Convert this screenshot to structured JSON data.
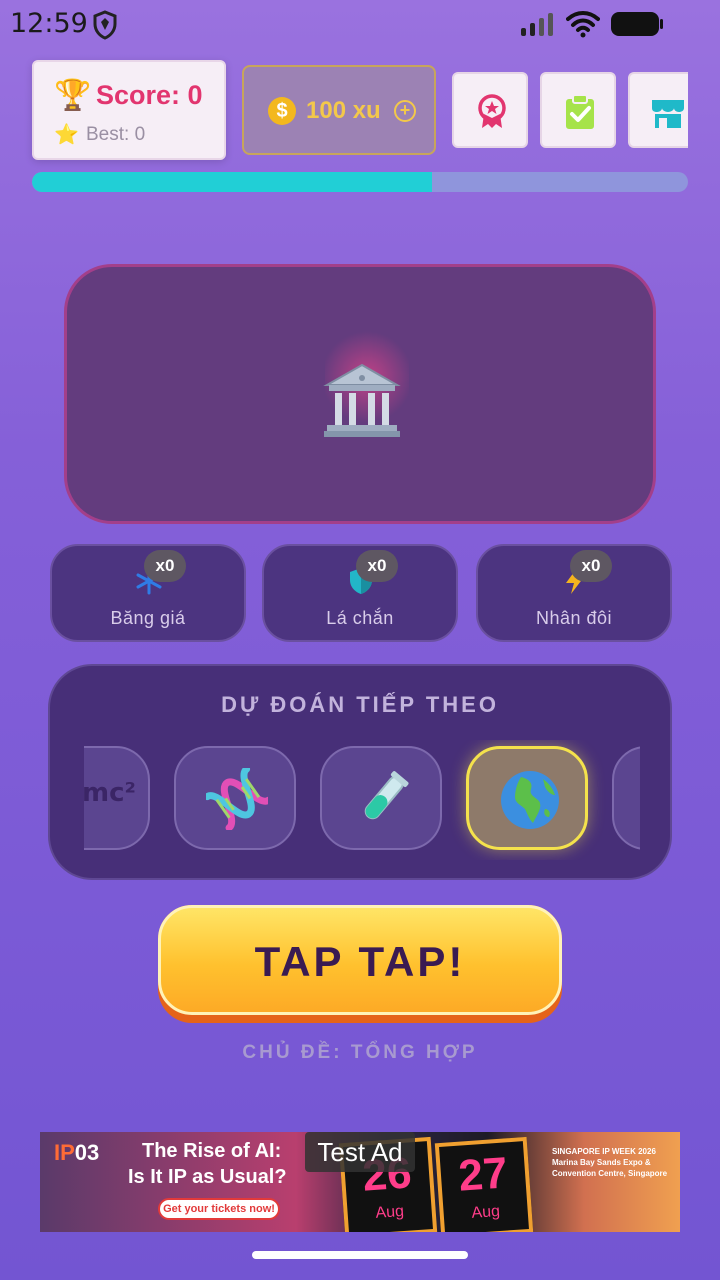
{
  "status_bar": {
    "time": "12:59",
    "icons": [
      "shield-icon",
      "signal-icon",
      "wifi-icon",
      "battery-icon"
    ]
  },
  "score_card": {
    "score_label": "Score: 0",
    "best_label": "Best: 0",
    "trophy_icon": "🏆",
    "star_icon": "⭐"
  },
  "coins": {
    "label": "100 xu",
    "coin_symbol": "$",
    "plus_symbol": "+"
  },
  "top_buttons": [
    {
      "name": "achievements",
      "icon": "medal-icon",
      "color": "#e2356f"
    },
    {
      "name": "tasks",
      "icon": "clipboard-check-icon",
      "color": "#a6e34a"
    },
    {
      "name": "shop",
      "icon": "store-icon",
      "color": "#1fb9c9"
    }
  ],
  "progress": {
    "fraction": 0.61,
    "fill_color": "#21cfd6",
    "track_color": "#8f95dc"
  },
  "display": {
    "current_item": "bank-building-icon",
    "glow_color": "#ff468c"
  },
  "powerups": [
    {
      "label": "Băng giá",
      "count": "x0",
      "icon": "snowflake-icon",
      "color": "#2f7ce6"
    },
    {
      "label": "Lá chắn",
      "count": "x0",
      "icon": "shield-icon",
      "color": "#22b6c8"
    },
    {
      "label": "Nhân đôi",
      "count": "x0",
      "icon": "lightning-icon",
      "color": "#f4b41e"
    }
  ],
  "prediction": {
    "title": "DỰ ĐOÁN TIẾP THEO",
    "tiles": [
      {
        "label": "mc²",
        "icon": "formula-icon",
        "active": false
      },
      {
        "label": "",
        "icon": "dna-icon",
        "active": false
      },
      {
        "label": "",
        "icon": "test-tube-icon",
        "active": false
      },
      {
        "label": "",
        "icon": "globe-icon",
        "active": true
      }
    ],
    "active_border": "#f4e24c"
  },
  "tap_button": {
    "label": "TAP TAP!"
  },
  "topic": {
    "label": "CHỦ ĐỀ: TỔNG HỢP"
  },
  "ad": {
    "test_label": "Test Ad",
    "logo_prefix": "IP",
    "logo_suffix": "03",
    "headline1": "The Rise of AI:",
    "headline2": "Is It IP as Usual?",
    "cta": "Get your tickets now!",
    "date1_num": "26",
    "date1_month": "Aug",
    "date2_num": "27",
    "date2_month": "Aug",
    "info": "SINGAPORE IP WEEK 2026 Marina Bay Sands Expo & Convention Centre, Singapore"
  }
}
